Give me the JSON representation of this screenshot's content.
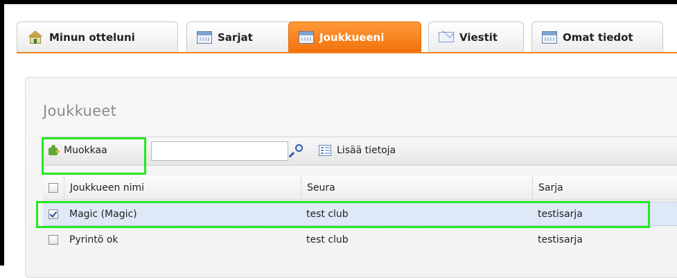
{
  "tabs": [
    {
      "label": "Minun otteluni",
      "icon": "home-icon",
      "active": false
    },
    {
      "label": "Sarjat",
      "icon": "calendar-icon",
      "active": false
    },
    {
      "label": "Joukkueeni",
      "icon": "calendar-icon",
      "active": true
    },
    {
      "label": "Viestit",
      "icon": "mail-icon",
      "active": false
    },
    {
      "label": "Omat tiedot",
      "icon": "calendar-icon",
      "active": false
    }
  ],
  "panel": {
    "title": "Joukkueet"
  },
  "toolbar": {
    "edit_label": "Muokkaa",
    "search_value": "",
    "more_label": "Lisää tietoja"
  },
  "grid": {
    "columns": [
      "Joukkueen nimi",
      "Seura",
      "Sarja"
    ],
    "rows": [
      {
        "name": "Magic (Magic)",
        "club": "test club",
        "series": "testisarja",
        "checked": true
      },
      {
        "name": "Pyrintö ok",
        "club": "test club",
        "series": "testisarja",
        "checked": false
      }
    ]
  },
  "colors": {
    "active_tab": "#f2720c",
    "highlight": "#22e822",
    "selected_row": "#dfe8f6"
  }
}
